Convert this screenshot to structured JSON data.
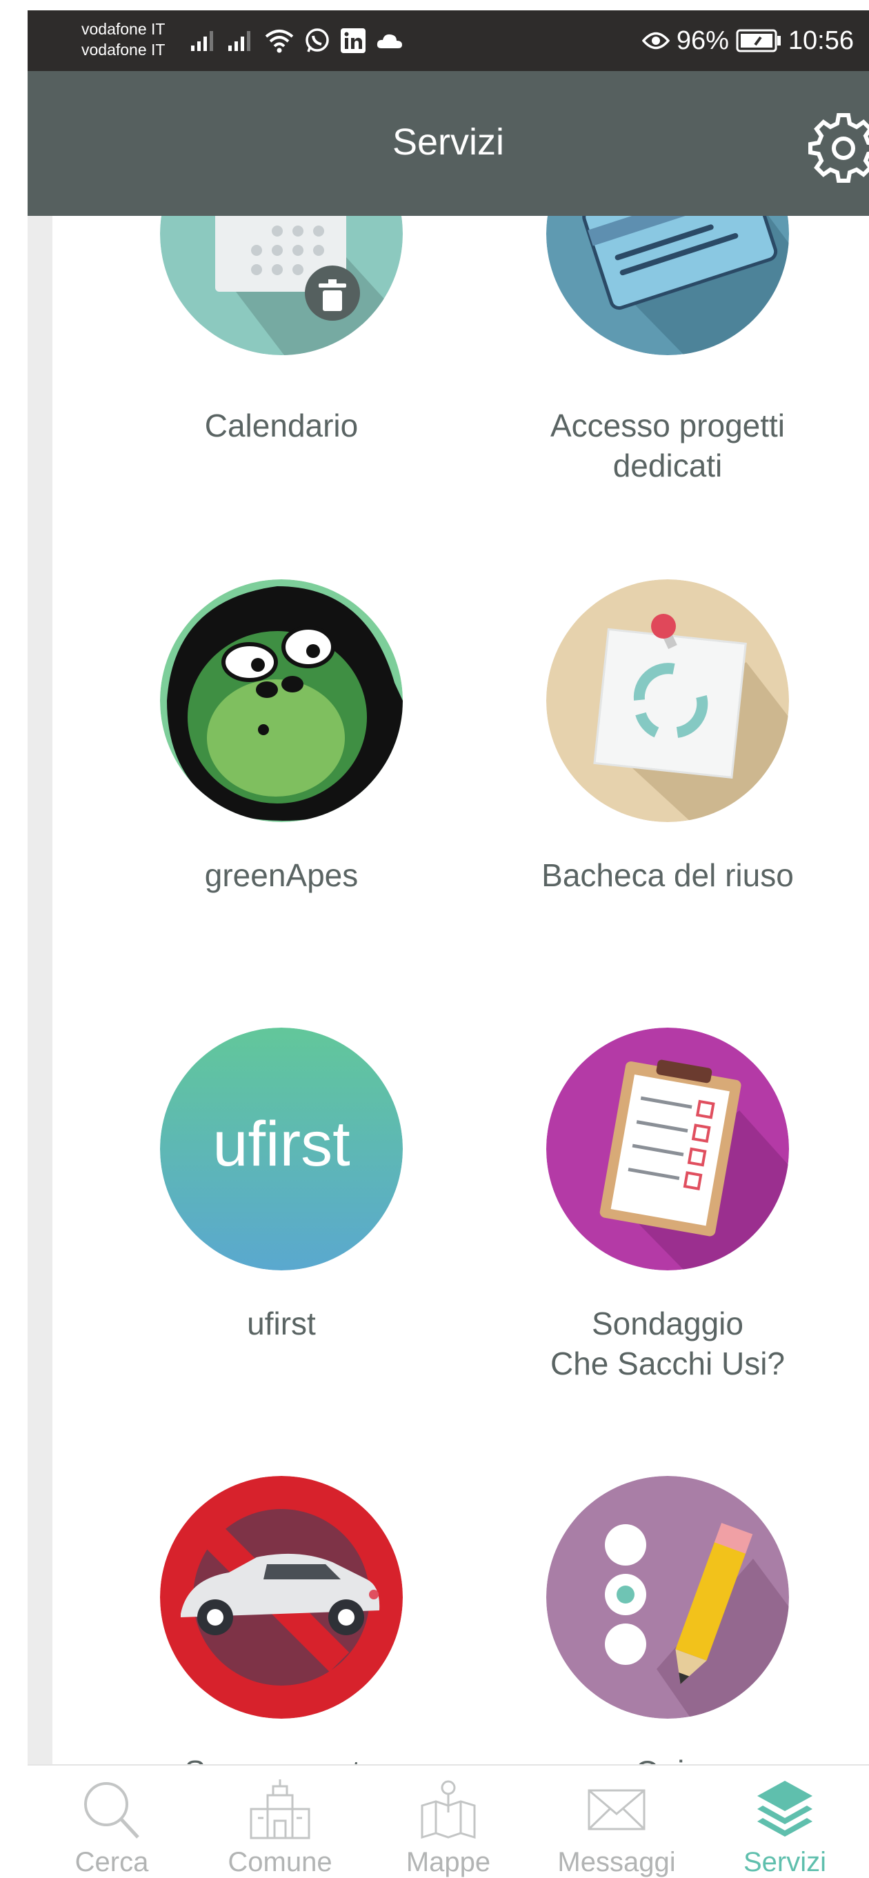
{
  "status_bar": {
    "carrier_1": "vodafone IT",
    "carrier_2": "vodafone IT",
    "battery": "96%",
    "time": "10:56",
    "icons": [
      "signal-icon",
      "signal-icon",
      "wifi-icon",
      "whatsapp-icon",
      "linkedin-icon",
      "cloud-icon",
      "eye-icon",
      "battery-icon"
    ]
  },
  "app_bar": {
    "title": "Servizi",
    "settings_icon": "gear-icon"
  },
  "services": [
    {
      "label": "Calendario",
      "icon": "calendar-icon"
    },
    {
      "label": "Accesso progetti\ndedicati",
      "icon": "card-icon"
    },
    {
      "label": "greenApes",
      "icon": "greenapes-logo-icon"
    },
    {
      "label": "Bacheca del riuso",
      "icon": "recycle-note-icon"
    },
    {
      "label": "ufirst",
      "icon": "ufirst-logo-icon",
      "logo_text": "ufirst"
    },
    {
      "label": "Sondaggio\nChe Sacchi Usi?",
      "icon": "clipboard-icon"
    },
    {
      "label": "Spazzamento",
      "icon": "no-parking-car-icon"
    },
    {
      "label": "Quiz",
      "icon": "quiz-pencil-icon"
    }
  ],
  "bottom_nav": [
    {
      "label": "Cerca",
      "icon": "search-icon",
      "active": false
    },
    {
      "label": "Comune",
      "icon": "town-hall-icon",
      "active": false
    },
    {
      "label": "Mappe",
      "icon": "map-icon",
      "active": false
    },
    {
      "label": "Messaggi",
      "icon": "mail-icon",
      "active": false
    },
    {
      "label": "Servizi",
      "icon": "layers-icon",
      "active": true
    }
  ],
  "colors": {
    "status_bar": "#2e2c2b",
    "app_bar": "#56605f",
    "accent": "#5fbfad",
    "label": "#5a6463",
    "nav_inactive": "#b2b4b4"
  }
}
